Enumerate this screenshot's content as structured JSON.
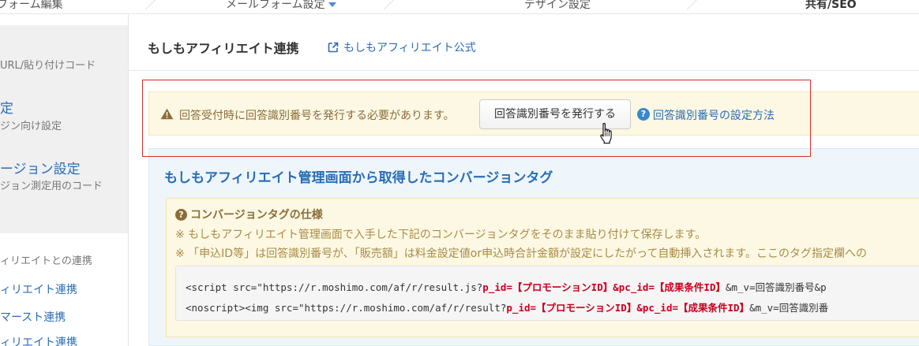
{
  "topnav": {
    "items": [
      {
        "label": "フォーム編集"
      },
      {
        "label": "メールフォーム設定"
      },
      {
        "label": "デザイン設定"
      },
      {
        "label": "共有/SEO"
      }
    ]
  },
  "sidebar": {
    "url_sub": "URL/貼り付けコード",
    "section1_title": "定",
    "section1_sub": "ジン向け設定",
    "section2_title": "ージョン設定",
    "section2_sub": "ジョン測定用のコード",
    "group_label": "ィリエイトとの連携",
    "links": [
      "ィリエイト連携",
      "マースト連携",
      "ィリエイト連携"
    ]
  },
  "main": {
    "title": "もしもアフィリエイト連携",
    "official_link": "もしもアフィリエイト公式",
    "warning": {
      "text": "回答受付時に回答識別番号を発行する必要があります。",
      "button": "回答識別番号を発行する",
      "help_link": "回答識別番号の設定方法"
    },
    "panel": {
      "title": "もしもアフィリエイト管理画面から取得したコンバージョンタグ",
      "spec_title": "コンバージョンタグの仕様",
      "note1": "※ もしもアフィリエイト管理画面で入手した下記のコンバージョンタグをそのまま貼り付けて保存します。",
      "note2": "※ 「申込ID等」は回答識別番号が、「販売額」は料金設定値or申込時合計金額が設定にしたがって自動挿入されます。ここのタグ指定欄への",
      "code": {
        "line1_pre": "<script src=\"https://r.moshimo.com/af/r/result.js?",
        "line1_hl1": "p_id=【プロモーションID】",
        "line1_mid": "&",
        "line1_hl2": "pc_id=【成果条件ID】",
        "line1_post": "&m_v=回答識別番号&p",
        "line2_pre": "<noscript><img src=\"https://r.moshimo.com/af/r/result?",
        "line2_hl1": "p_id=【プロモーションID】",
        "line2_mid": "&",
        "line2_hl2": "pc_id=【成果条件ID】",
        "line2_post": "&m_v=回答識別番"
      }
    }
  },
  "colors": {
    "link": "#2a6cb5",
    "warning_bg": "#fcf8e3",
    "warning_text": "#8a6d3b",
    "highlight_box": "#d32f2f",
    "panel_bg": "#eef6fc",
    "code_highlight": "#c7001e"
  }
}
